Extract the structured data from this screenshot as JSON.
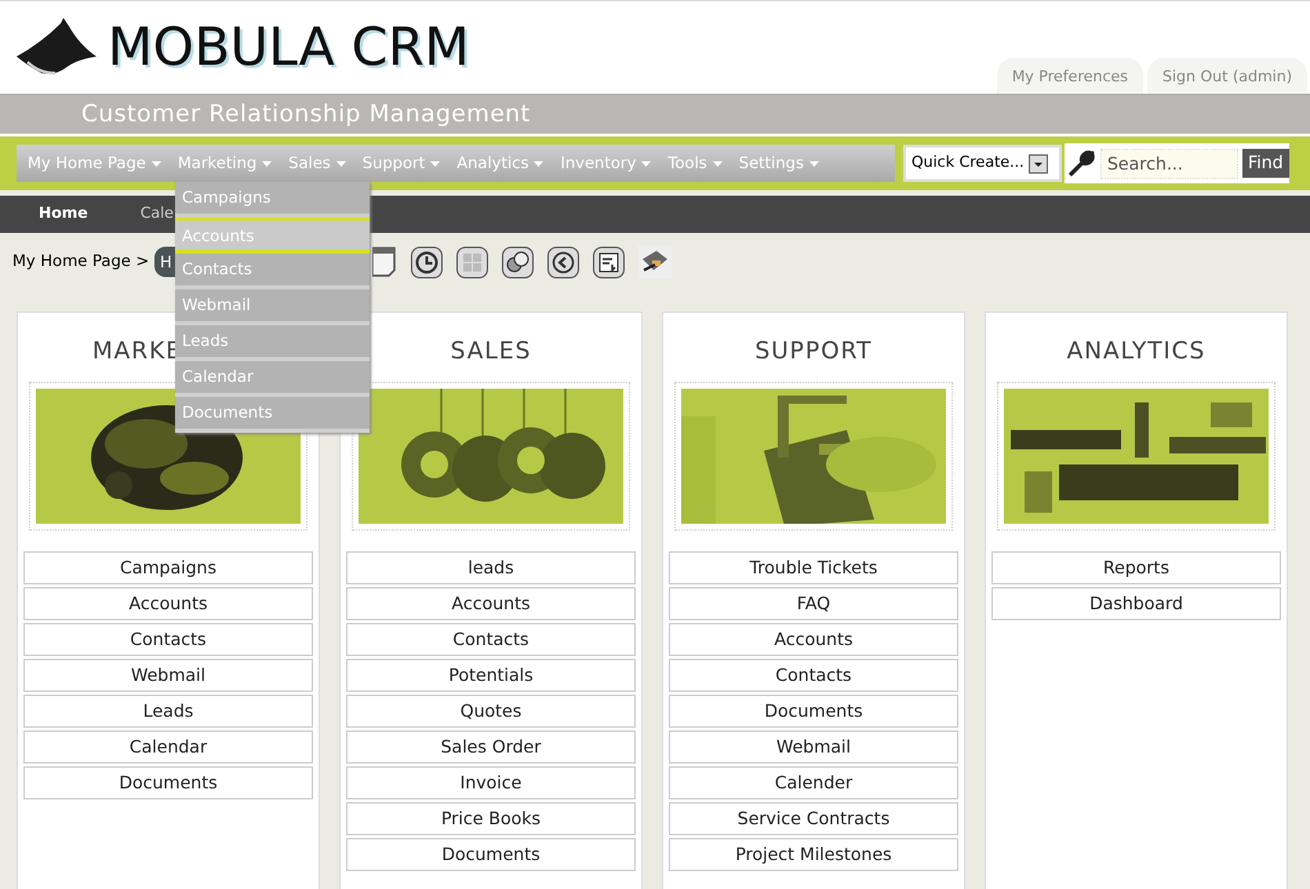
{
  "logo": {
    "title": "MOBULA CRM"
  },
  "header_links": [
    "My Preferences",
    "Sign Out (admin)"
  ],
  "tagline": "Customer Relationship Management",
  "main_menu": [
    "My Home Page",
    "Marketing",
    "Sales",
    "Support",
    "Analytics",
    "Inventory",
    "Tools",
    "Settings"
  ],
  "dropdown": [
    {
      "label": "Campaigns",
      "selected": false
    },
    {
      "label": "Accounts",
      "selected": true
    },
    {
      "label": "Contacts",
      "selected": false
    },
    {
      "label": "Webmail",
      "selected": false
    },
    {
      "label": "Leads",
      "selected": false
    },
    {
      "label": "Calendar",
      "selected": false
    },
    {
      "label": "Documents",
      "selected": false
    }
  ],
  "quick_create": {
    "value": "Quick Create..."
  },
  "search": {
    "placeholder": "Search...",
    "button": "Find"
  },
  "sub_nav": [
    {
      "label": "Home",
      "selected": true
    },
    {
      "label": "Cale",
      "selected": false
    }
  ],
  "breadcrumb": {
    "text": "My Home Page >",
    "current": "H"
  },
  "columns": [
    {
      "title": "MARKE",
      "cut": true,
      "links": [
        "Campaigns",
        "Accounts",
        "Contacts",
        "Webmail",
        "Leads",
        "Calendar",
        "Documents"
      ]
    },
    {
      "title": "SALES",
      "cut": false,
      "links": [
        "leads",
        "Accounts",
        "Contacts",
        "Potentials",
        "Quotes",
        "Sales Order",
        "Invoice",
        "Price Books",
        "Documents"
      ]
    },
    {
      "title": "SUPPORT",
      "cut": false,
      "links": [
        "Trouble Tickets",
        "FAQ",
        "Accounts",
        "Contacts",
        "Documents",
        "Webmail",
        "Calender",
        "Service Contracts",
        "Project Milestones"
      ]
    },
    {
      "title": "ANALYTICS",
      "cut": false,
      "links": [
        "Reports",
        "Dashboard"
      ]
    }
  ]
}
